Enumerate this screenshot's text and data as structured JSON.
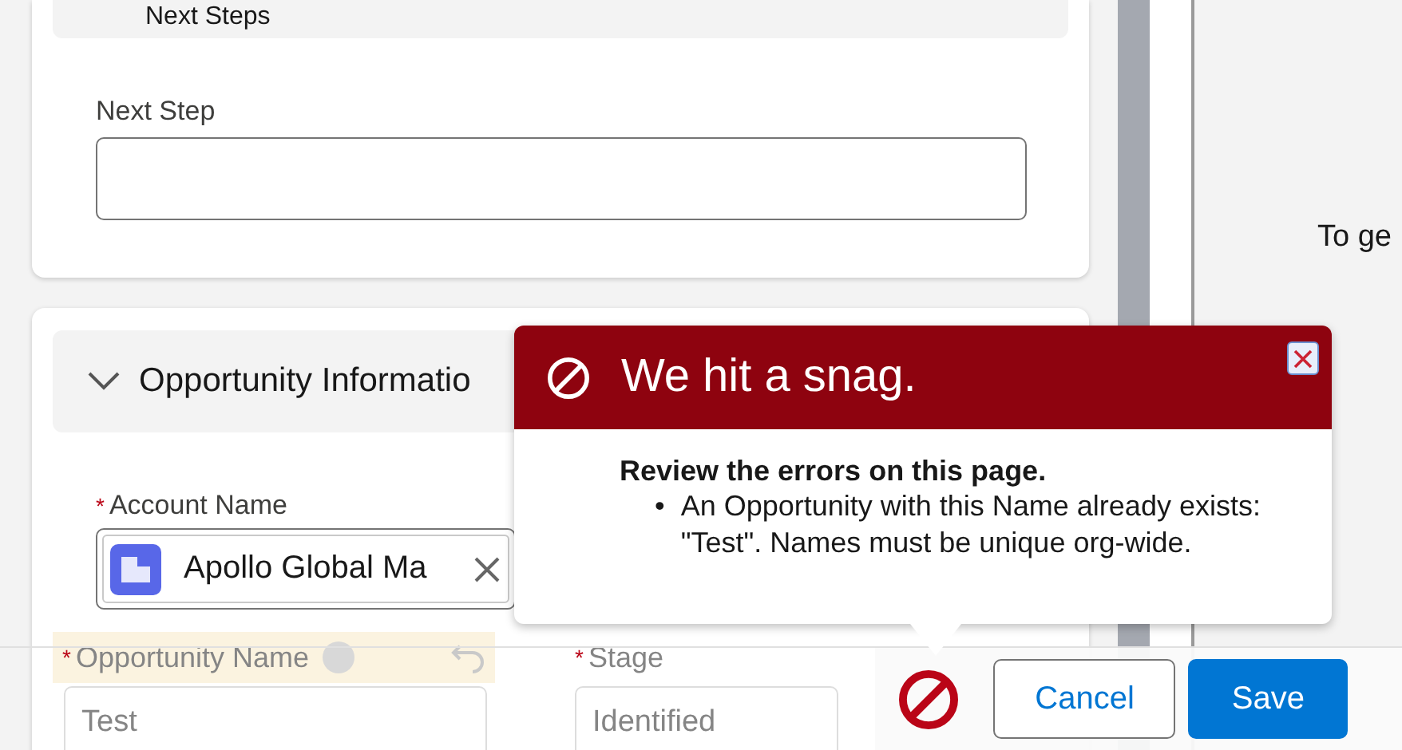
{
  "next_steps_section": {
    "title": "Next Steps",
    "field": {
      "label": "Next Step"
    }
  },
  "opportunity_section": {
    "title": "Opportunity Informatio",
    "expanded": true,
    "account_name": {
      "label": "Account Name",
      "required_mark": "*",
      "value": "Apollo Global Ma"
    },
    "opportunity_name": {
      "label": "Opportunity Name",
      "required_mark": "*",
      "value": "Test"
    },
    "stage": {
      "label": "Stage",
      "required_mark": "*",
      "value": "Identified"
    }
  },
  "right_panel": {
    "text": "To ge"
  },
  "error_popover": {
    "title": "We hit a snag.",
    "heading": "Review the errors on this page.",
    "errors": [
      {
        "bullet": "•",
        "text": "An Opportunity with this Name already exists: \"Test\". Names must be unique org-wide."
      }
    ]
  },
  "footer": {
    "buttons": [
      {
        "label": "Cancel",
        "kind": "neutral"
      },
      {
        "label": "Save",
        "kind": "brand"
      }
    ]
  }
}
